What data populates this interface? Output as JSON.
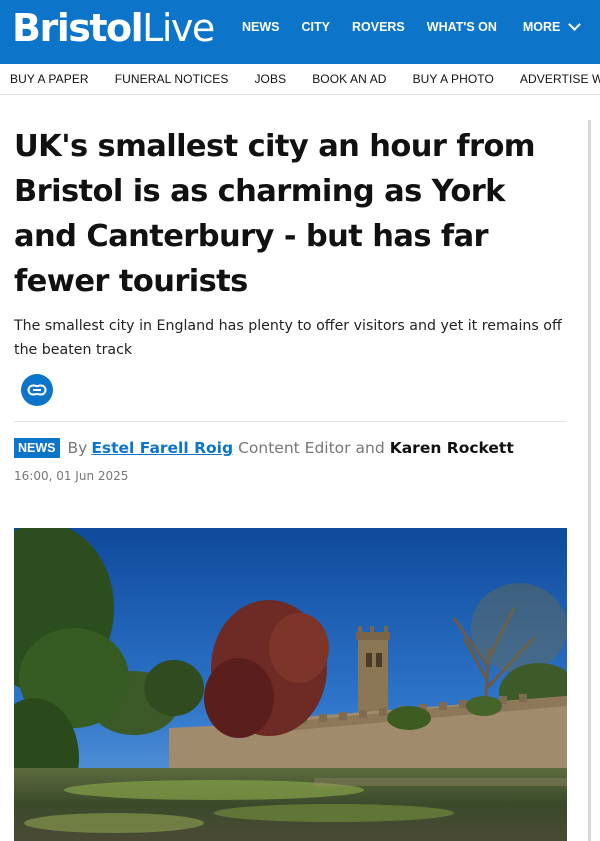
{
  "header": {
    "logo_bold": "Bristol",
    "logo_light": "Live",
    "nav": [
      "NEWS",
      "CITY",
      "ROVERS",
      "WHAT'S ON"
    ],
    "more_label": "MORE"
  },
  "subnav": [
    "BUY A PAPER",
    "FUNERAL NOTICES",
    "JOBS",
    "BOOK AN AD",
    "BUY A PHOTO",
    "ADVERTISE WITH"
  ],
  "article": {
    "headline": "UK's smallest city an hour from Bristol is as charming as York and Canterbury - but has far fewer tourists",
    "standfirst": "The smallest city in England has plenty to offer visitors and yet it remains off the beaten track",
    "category": "NEWS",
    "by": "By",
    "author1": "Estel Farell Roig",
    "author1_role": "Content Editor",
    "and": "and",
    "author2": "Karen Rockett",
    "timestamp": "16:00, 01 Jun 2025"
  },
  "colors": {
    "brand": "#0c75c9"
  },
  "icons": {
    "share": "link-icon",
    "more": "chevron-down-icon"
  }
}
